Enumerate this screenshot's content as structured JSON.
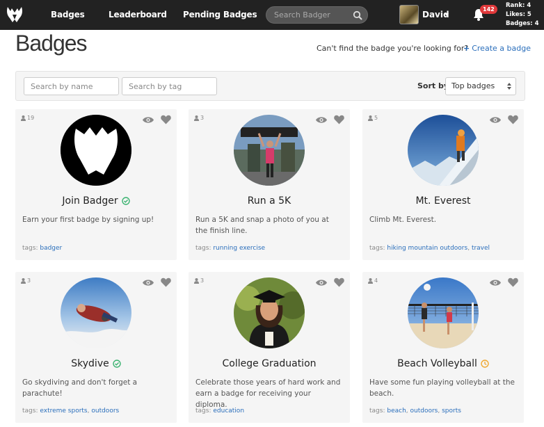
{
  "nav": {
    "links": [
      "Badges",
      "Leaderboard",
      "Pending Badges"
    ],
    "search_placeholder": "Search Badger",
    "user_name": "David",
    "notification_count": "142",
    "stats": [
      "Rank: 4",
      "Likes: 5",
      "Badges: 4"
    ]
  },
  "header": {
    "title": "Badges",
    "cant_find": "Can't find the badge you're looking for?",
    "create_label": "Create a badge"
  },
  "filters": {
    "name_placeholder": "Search by name",
    "tag_placeholder": "Search by tag",
    "sort_label": "Sort by",
    "sort_value": "Top badges"
  },
  "badges": [
    {
      "count": "19",
      "title": "Join Badger",
      "status": "completed",
      "description": "Earn your first badge by signing up!",
      "tags_label": "tags:",
      "tags": [
        "badger"
      ]
    },
    {
      "count": "3",
      "title": "Run a 5K",
      "status": "none",
      "description": "Run a 5K and snap a photo of you at the finish line.",
      "tags_label": "tags:",
      "tags": [
        "running exercise"
      ]
    },
    {
      "count": "5",
      "title": "Mt. Everest",
      "status": "none",
      "description": "Climb Mt. Everest.",
      "tags_label": "tags:",
      "tags": [
        "hiking mountain outdoors",
        "travel"
      ]
    },
    {
      "count": "3",
      "title": "Skydive",
      "status": "completed",
      "description": "Go skydiving and don't forget a parachute!",
      "tags_label": "tags:",
      "tags": [
        "extreme sports",
        "outdoors"
      ]
    },
    {
      "count": "3",
      "title": "College Graduation",
      "status": "none",
      "description": "Celebrate those years of hard work and earn a badge for receiving your diploma.",
      "tags_label": "tags:",
      "tags": [
        "education"
      ]
    },
    {
      "count": "4",
      "title": "Beach Volleyball",
      "status": "pending",
      "description": "Have some fun playing volleyball at the beach.",
      "tags_label": "tags:",
      "tags": [
        "beach",
        "outdoors",
        "sports"
      ]
    }
  ],
  "colors": {
    "navbar": "#222222",
    "link": "#2a6ebb",
    "completed": "#3cb371",
    "pending": "#f0a830",
    "notification": "#e0383a"
  }
}
